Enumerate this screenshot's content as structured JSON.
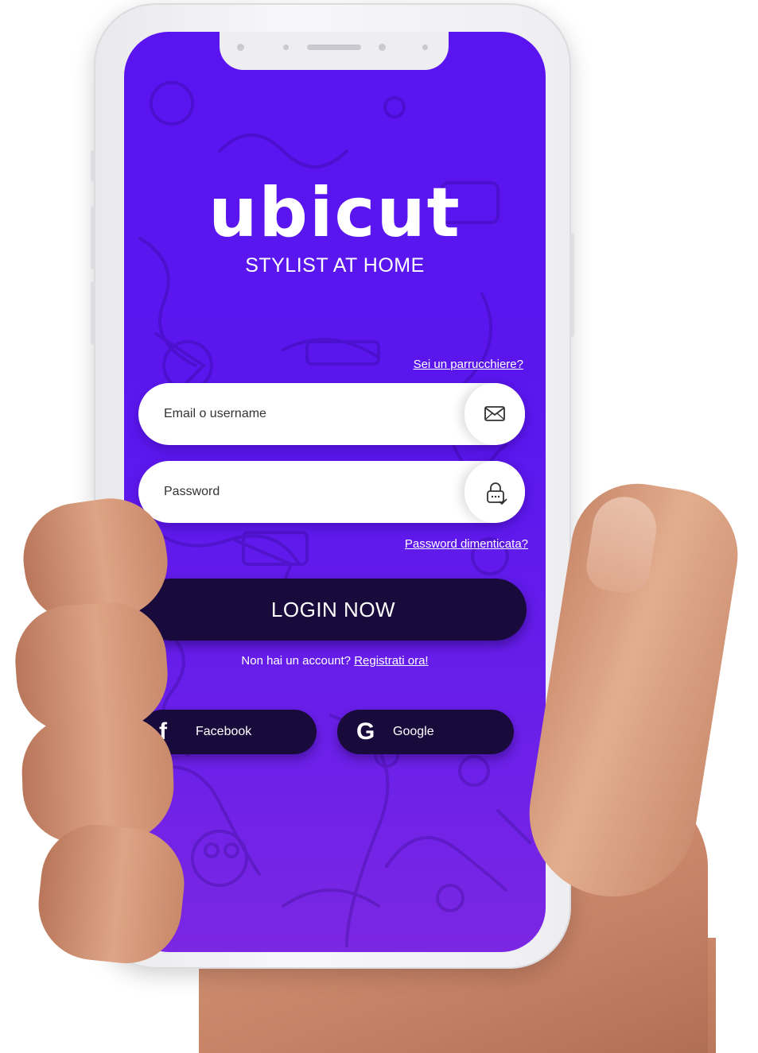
{
  "brand": {
    "logo_text": "ubicut",
    "tagline": "STYLIST AT HOME"
  },
  "links": {
    "stylist_link": "Sei un parrucchiere?",
    "forgot_password": "Password dimenticata?"
  },
  "form": {
    "email_placeholder": "Email o username",
    "email_icon": "envelope-icon",
    "password_placeholder": "Password",
    "password_icon": "lock-icon"
  },
  "login_button": "LOGIN NOW",
  "signup": {
    "prompt": "Non hai un account?",
    "link": "Registrati ora!"
  },
  "social": [
    {
      "icon_glyph": "f",
      "icon": "facebook-icon",
      "label": "Facebook"
    },
    {
      "icon_glyph": "G",
      "icon": "google-icon",
      "label": "Google"
    }
  ],
  "colors": {
    "screen_background": "#5a14f0",
    "button_dark": "#180b3c",
    "text_light": "#ffffff"
  }
}
